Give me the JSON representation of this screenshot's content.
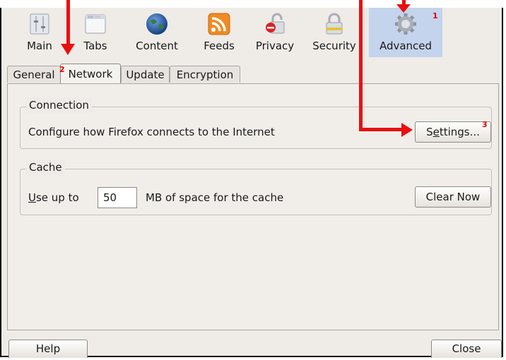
{
  "toolbar": {
    "panes": [
      {
        "label": "Main",
        "icon": "main-icon"
      },
      {
        "label": "Tabs",
        "icon": "tabs-icon"
      },
      {
        "label": "Content",
        "icon": "content-globe-icon"
      },
      {
        "label": "Feeds",
        "icon": "feeds-rss-icon"
      },
      {
        "label": "Privacy",
        "icon": "privacy-icon"
      },
      {
        "label": "Security",
        "icon": "security-padlock-icon"
      },
      {
        "label": "Advanced",
        "icon": "advanced-gear-icon",
        "active": true
      }
    ]
  },
  "subtabs": [
    {
      "label": "General"
    },
    {
      "label": "Network",
      "active": true
    },
    {
      "label": "Update"
    },
    {
      "label": "Encryption"
    }
  ],
  "connection": {
    "legend": "Connection",
    "description": "Configure how Firefox connects to the Internet",
    "settings_label": "Settings...",
    "settings_mnemonic": "e"
  },
  "cache": {
    "legend": "Cache",
    "use_up_to": "Use up to",
    "mnemonic": "U",
    "value": "50",
    "suffix": "MB of space for the cache",
    "clear_label": "Clear Now"
  },
  "footer": {
    "help_label": "Help",
    "close_label": "Close"
  },
  "annotations": {
    "step1": "1",
    "step2": "2",
    "step3": "3",
    "color": "#e81010"
  }
}
